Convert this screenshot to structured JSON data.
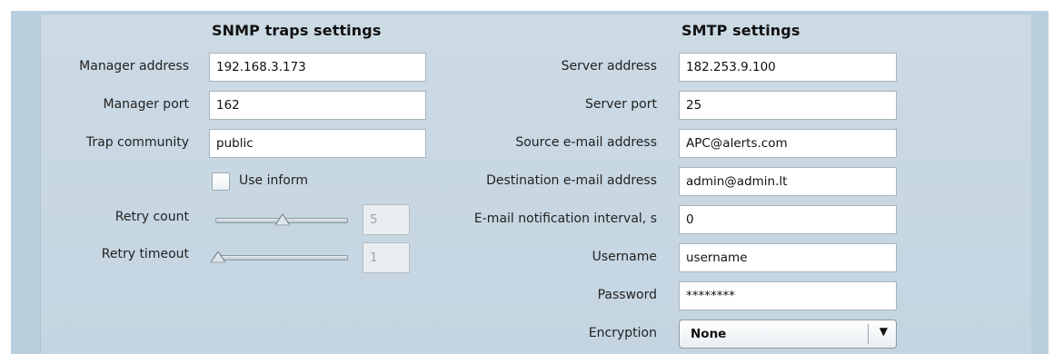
{
  "snmp": {
    "title": "SNMP traps settings",
    "manager_address_label": "Manager address",
    "manager_address": "192.168.3.173",
    "manager_port_label": "Manager port",
    "manager_port": "162",
    "trap_community_label": "Trap community",
    "trap_community": "public",
    "use_inform_label": "Use inform",
    "use_inform_checked": false,
    "retry_count_label": "Retry count",
    "retry_count": "5",
    "retry_count_level": 0.5,
    "retry_timeout_label": "Retry timeout",
    "retry_timeout": "1",
    "retry_timeout_level": 0.0
  },
  "smtp": {
    "title": "SMTP settings",
    "server_address_label": "Server address",
    "server_address": "182.253.9.100",
    "server_port_label": "Server port",
    "server_port": "25",
    "source_email_label": "Source e-mail address",
    "source_email": "APC@alerts.com",
    "destination_email_label": "Destination e-mail address",
    "destination_email": "admin@admin.lt",
    "interval_label": "E-mail notification interval, s",
    "interval": "0",
    "username_label": "Username",
    "username": "username",
    "password_label": "Password",
    "password": "********",
    "encryption_label": "Encryption",
    "encryption": "None",
    "encryption_arrow_icon": "triangle-down"
  },
  "colors": {
    "panel_bg": "#c8d8e3",
    "frame_bg": "#b9cfdd"
  }
}
